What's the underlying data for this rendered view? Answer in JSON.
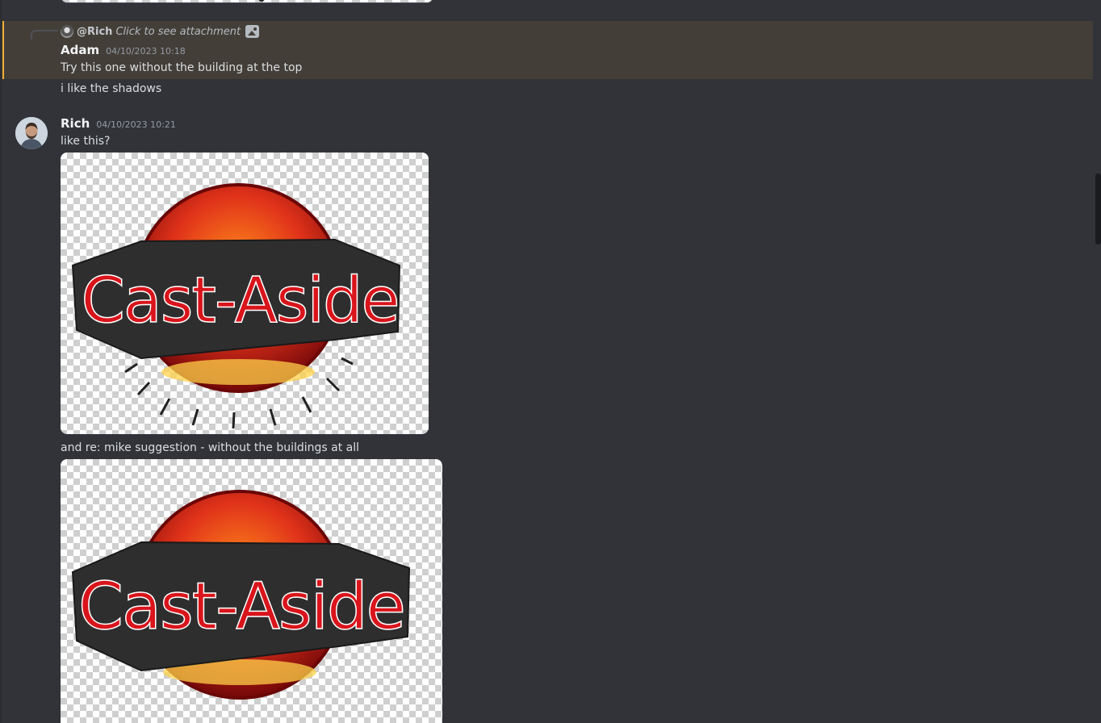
{
  "reply": {
    "author": "@Rich",
    "text": "Click to see attachment",
    "icon": "image-icon"
  },
  "messages": [
    {
      "author": "Adam",
      "timestamp": "04/10/2023 10:18",
      "lines": [
        "Try this one without the building at the top",
        "i like the shadows"
      ]
    },
    {
      "author": "Rich",
      "timestamp": "04/10/2023 10:21",
      "lines": [
        "like this?",
        "and re: mike suggestion - without the buildings at all"
      ],
      "logo_text": "Cast-Aside"
    }
  ],
  "colors": {
    "background": "#313338",
    "mention_highlight": "#433e38",
    "mention_bar": "#f0b132",
    "logo_red": "#d9141b",
    "banner": "#2e2e2e"
  }
}
